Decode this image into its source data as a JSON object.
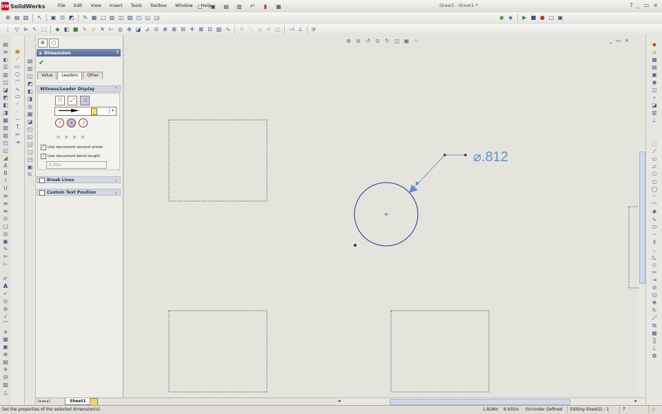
{
  "app": {
    "name": "SolidWorks",
    "document_title": "Draw3 - Sheet1 *"
  },
  "menu": [
    "File",
    "Edit",
    "View",
    "Insert",
    "Tools",
    "Toolbox",
    "Window",
    "Help"
  ],
  "window_controls": [
    "?",
    "_",
    "▭",
    "×"
  ],
  "property_manager": {
    "title": "Dimension",
    "help": "?",
    "tabs": [
      "Value",
      "Leaders",
      "Other"
    ],
    "active_tab": "Leaders",
    "sections": {
      "witness_leader": "Witness/Leader Display",
      "break_lines": "Break Lines",
      "custom_text_position": "Custom Text Position"
    },
    "checkboxes": {
      "second_arrow": "Use document second arrow",
      "bend_length": "Use document bend length"
    },
    "bend_length_value": "0.25in"
  },
  "drawing": {
    "dimension_text": "⌀.812",
    "accent_color": "#5d8fd6",
    "circle_color": "#2a2aa0"
  },
  "sheet": {
    "tab_label": "Sheet1"
  },
  "status": {
    "message": "Set the properties of the selected dimension(s).",
    "x": "1.828in",
    "y": "6.935in",
    "z": "0in",
    "state": "Under Defined",
    "editing": "Editing Sheet1",
    "scale": "1 : 1"
  }
}
